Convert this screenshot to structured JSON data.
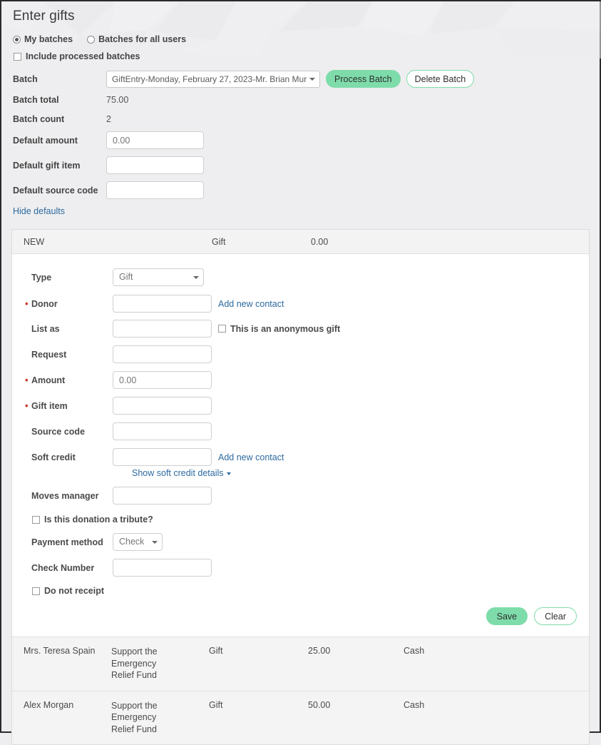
{
  "page": {
    "title": "Enter gifts"
  },
  "scope": {
    "my_batches_label": "My batches",
    "all_users_label": "Batches for all users",
    "include_processed_label": "Include processed batches"
  },
  "batch": {
    "label": "Batch",
    "selected": "GiftEntry-Monday, February 27, 2023-Mr. Brian Mur",
    "process_button": "Process Batch",
    "delete_button": "Delete Batch",
    "total_label": "Batch total",
    "total_value": "75.00",
    "count_label": "Batch count",
    "count_value": "2"
  },
  "defaults": {
    "amount_label": "Default amount",
    "amount_value": "0.00",
    "gift_item_label": "Default gift item",
    "gift_item_value": "",
    "source_code_label": "Default source code",
    "source_code_value": "",
    "hide_link": "Hide defaults"
  },
  "entry_header": {
    "status": "NEW",
    "type": "Gift",
    "amount": "0.00"
  },
  "form": {
    "type_label": "Type",
    "type_value": "Gift",
    "donor_label": "Donor",
    "donor_value": "",
    "donor_add_link": "Add new contact",
    "list_as_label": "List as",
    "list_as_value": "",
    "anonymous_label": "This is an anonymous gift",
    "request_label": "Request",
    "request_value": "",
    "amount_label": "Amount",
    "amount_value": "0.00",
    "gift_item_label": "Gift item",
    "gift_item_value": "",
    "source_code_label": "Source code",
    "source_code_value": "",
    "soft_credit_label": "Soft credit",
    "soft_credit_value": "",
    "soft_credit_add_link": "Add new contact",
    "soft_credit_details_link": "Show soft credit details",
    "moves_manager_label": "Moves manager",
    "moves_manager_value": "",
    "tribute_label": "Is this donation a tribute?",
    "payment_method_label": "Payment method",
    "payment_method_value": "Check",
    "check_number_label": "Check Number",
    "check_number_value": "",
    "do_not_receipt_label": "Do not receipt",
    "save_button": "Save",
    "clear_button": "Clear"
  },
  "gifts": [
    {
      "donor": "Mrs. Teresa Spain",
      "designation": "Support the Emergency Relief Fund",
      "type": "Gift",
      "amount": "25.00",
      "method": "Cash"
    },
    {
      "donor": "Alex Morgan",
      "designation": "Support the Emergency Relief Fund",
      "type": "Gift",
      "amount": "50.00",
      "method": "Cash"
    }
  ],
  "colors": {
    "accent": "#7edcaa",
    "link": "#2d6a9f",
    "required": "#d0342c",
    "background": "#eeeef0"
  }
}
